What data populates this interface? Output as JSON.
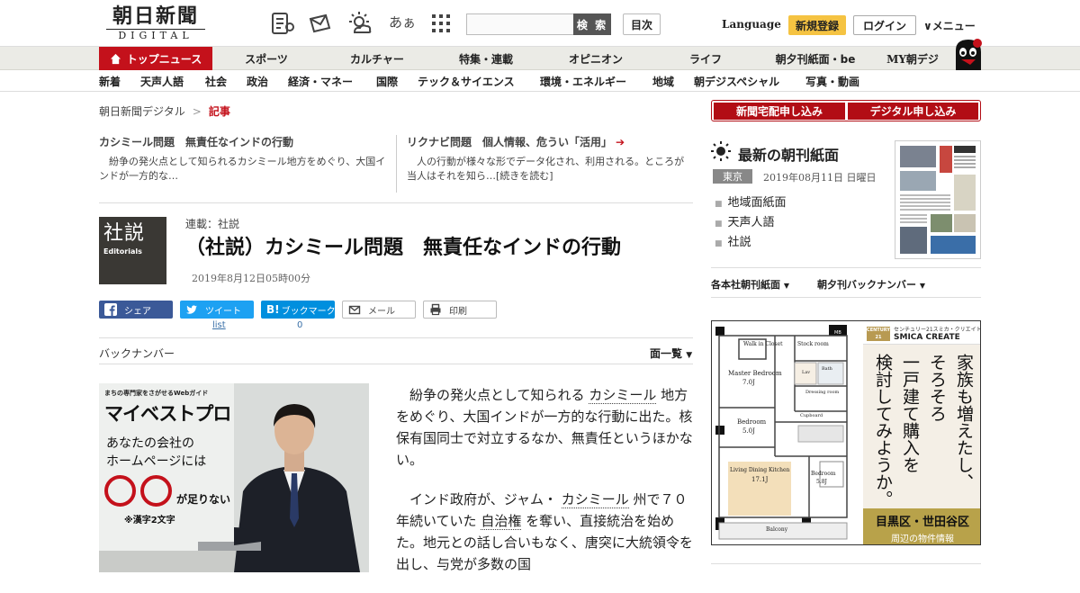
{
  "header": {
    "logo_ja": "朝日新聞",
    "logo_en": "DIGITAL",
    "font_size_label": "あぁ",
    "search_placeholder": "",
    "search_button": "検 索",
    "toc_button": "目次",
    "language": "Language",
    "register": "新規登録",
    "login": "ログイン",
    "menu": "メニュー"
  },
  "nav_primary": [
    "トップニュース",
    "スポーツ",
    "カルチャー",
    "特集・連載",
    "オピニオン",
    "ライフ",
    "朝夕刊紙面・be",
    "MY朝デジ"
  ],
  "nav_secondary": [
    "新着",
    "天声人語",
    "社会",
    "政治",
    "経済・マネー",
    "国際",
    "テック＆サイエンス",
    "環境・エネルギー",
    "地域",
    "朝デジスペシャル",
    "写真・動画"
  ],
  "breadcrumb": {
    "home": "朝日新聞デジタル",
    "separator": ">",
    "current": "記事"
  },
  "teasers": [
    {
      "title": "カシミール問題　無責任なインドの行動",
      "desc": "紛争の発火点として知られるカシミール地方をめぐり、大国インドが一方的な…"
    },
    {
      "title": "リクナビ問題　個人情報、危うい「活用」",
      "desc": "人の行動が様々な形でデータ化され、利用される。ところが当人はそれを知ら…[続きを読む]"
    }
  ],
  "article": {
    "editorial_kanji": "社説",
    "editorial_en": "Editorials",
    "series": "連載：社説",
    "title": "（社説）カシミール問題　無責任なインドの行動",
    "date": "2019年8月12日05時00分"
  },
  "share": {
    "facebook": "シェア",
    "twitter": "ツイート",
    "twitter_count": "list",
    "hatena": "ブックマーク",
    "hatena_count": "0",
    "mail": "メール",
    "print": "印刷"
  },
  "backnumber": {
    "label": "バックナンバー",
    "list_toggle": "面一覧"
  },
  "ad_left": {
    "tagline": "まちの専門家をさがせるWebガイド",
    "brand": "マイベストプロ",
    "line1": "あなたの会社の",
    "line2": "ホームページには",
    "suffix": "が足りない",
    "note": "※漢字2文字"
  },
  "body": {
    "p1": [
      "紛争の発火点として知られる",
      "カシミール",
      "地方をめぐり、大国インドが一方的な行動に出た。核保有国同士で対立するなか、無責任というほかない。"
    ],
    "p2": [
      "インド政府が、ジャム・",
      "カシミール",
      "州で７０年続いていた",
      "自治権",
      "を奪い、直接統治を始めた。地元との話し合いもなく、",
      "唐突に大統領令を出し、与党が多数の国"
    ]
  },
  "sidebar": {
    "subscribe_home": "新聞宅配申し込み",
    "subscribe_digital": "デジタル申し込み",
    "latest_title": "最新の朝刊紙面",
    "edition": "東京",
    "paper_date": "2019年08月11日 日曜日",
    "links": [
      "地域面紙面",
      "天声人語",
      "社説"
    ],
    "dropdowns": [
      "各本社朝刊紙面",
      "朝夕刊バックナンバー"
    ]
  },
  "ad_right": {
    "company_tag": "センチュリー21スミカ・クリエイト",
    "company": "SMICA CREATE",
    "brand_mark": "CENTURY 21",
    "vertical_text": [
      "家族も増えたし、",
      "そろそろ",
      "一戸建て購入を",
      "検討してみようか。"
    ],
    "area": "目黒区・世田谷区",
    "area_sub": "周辺の物件情報",
    "rooms": [
      "Walk in Closet",
      "Stock room",
      "Master Bedroom",
      "7.0J",
      "Bedroom",
      "5.0J",
      "Living Dining Kitchen",
      "17.1J",
      "Bedroom",
      "5.8J",
      "Balcony",
      "Bath",
      "Lav",
      "Dressing room",
      "Cupboard",
      "MB"
    ]
  },
  "colors": {
    "brand_red": "#c4111b",
    "facebook": "#3b5998",
    "twitter": "#1da1f2",
    "hatena": "#008fde",
    "register_yellow": "#f5c342"
  }
}
